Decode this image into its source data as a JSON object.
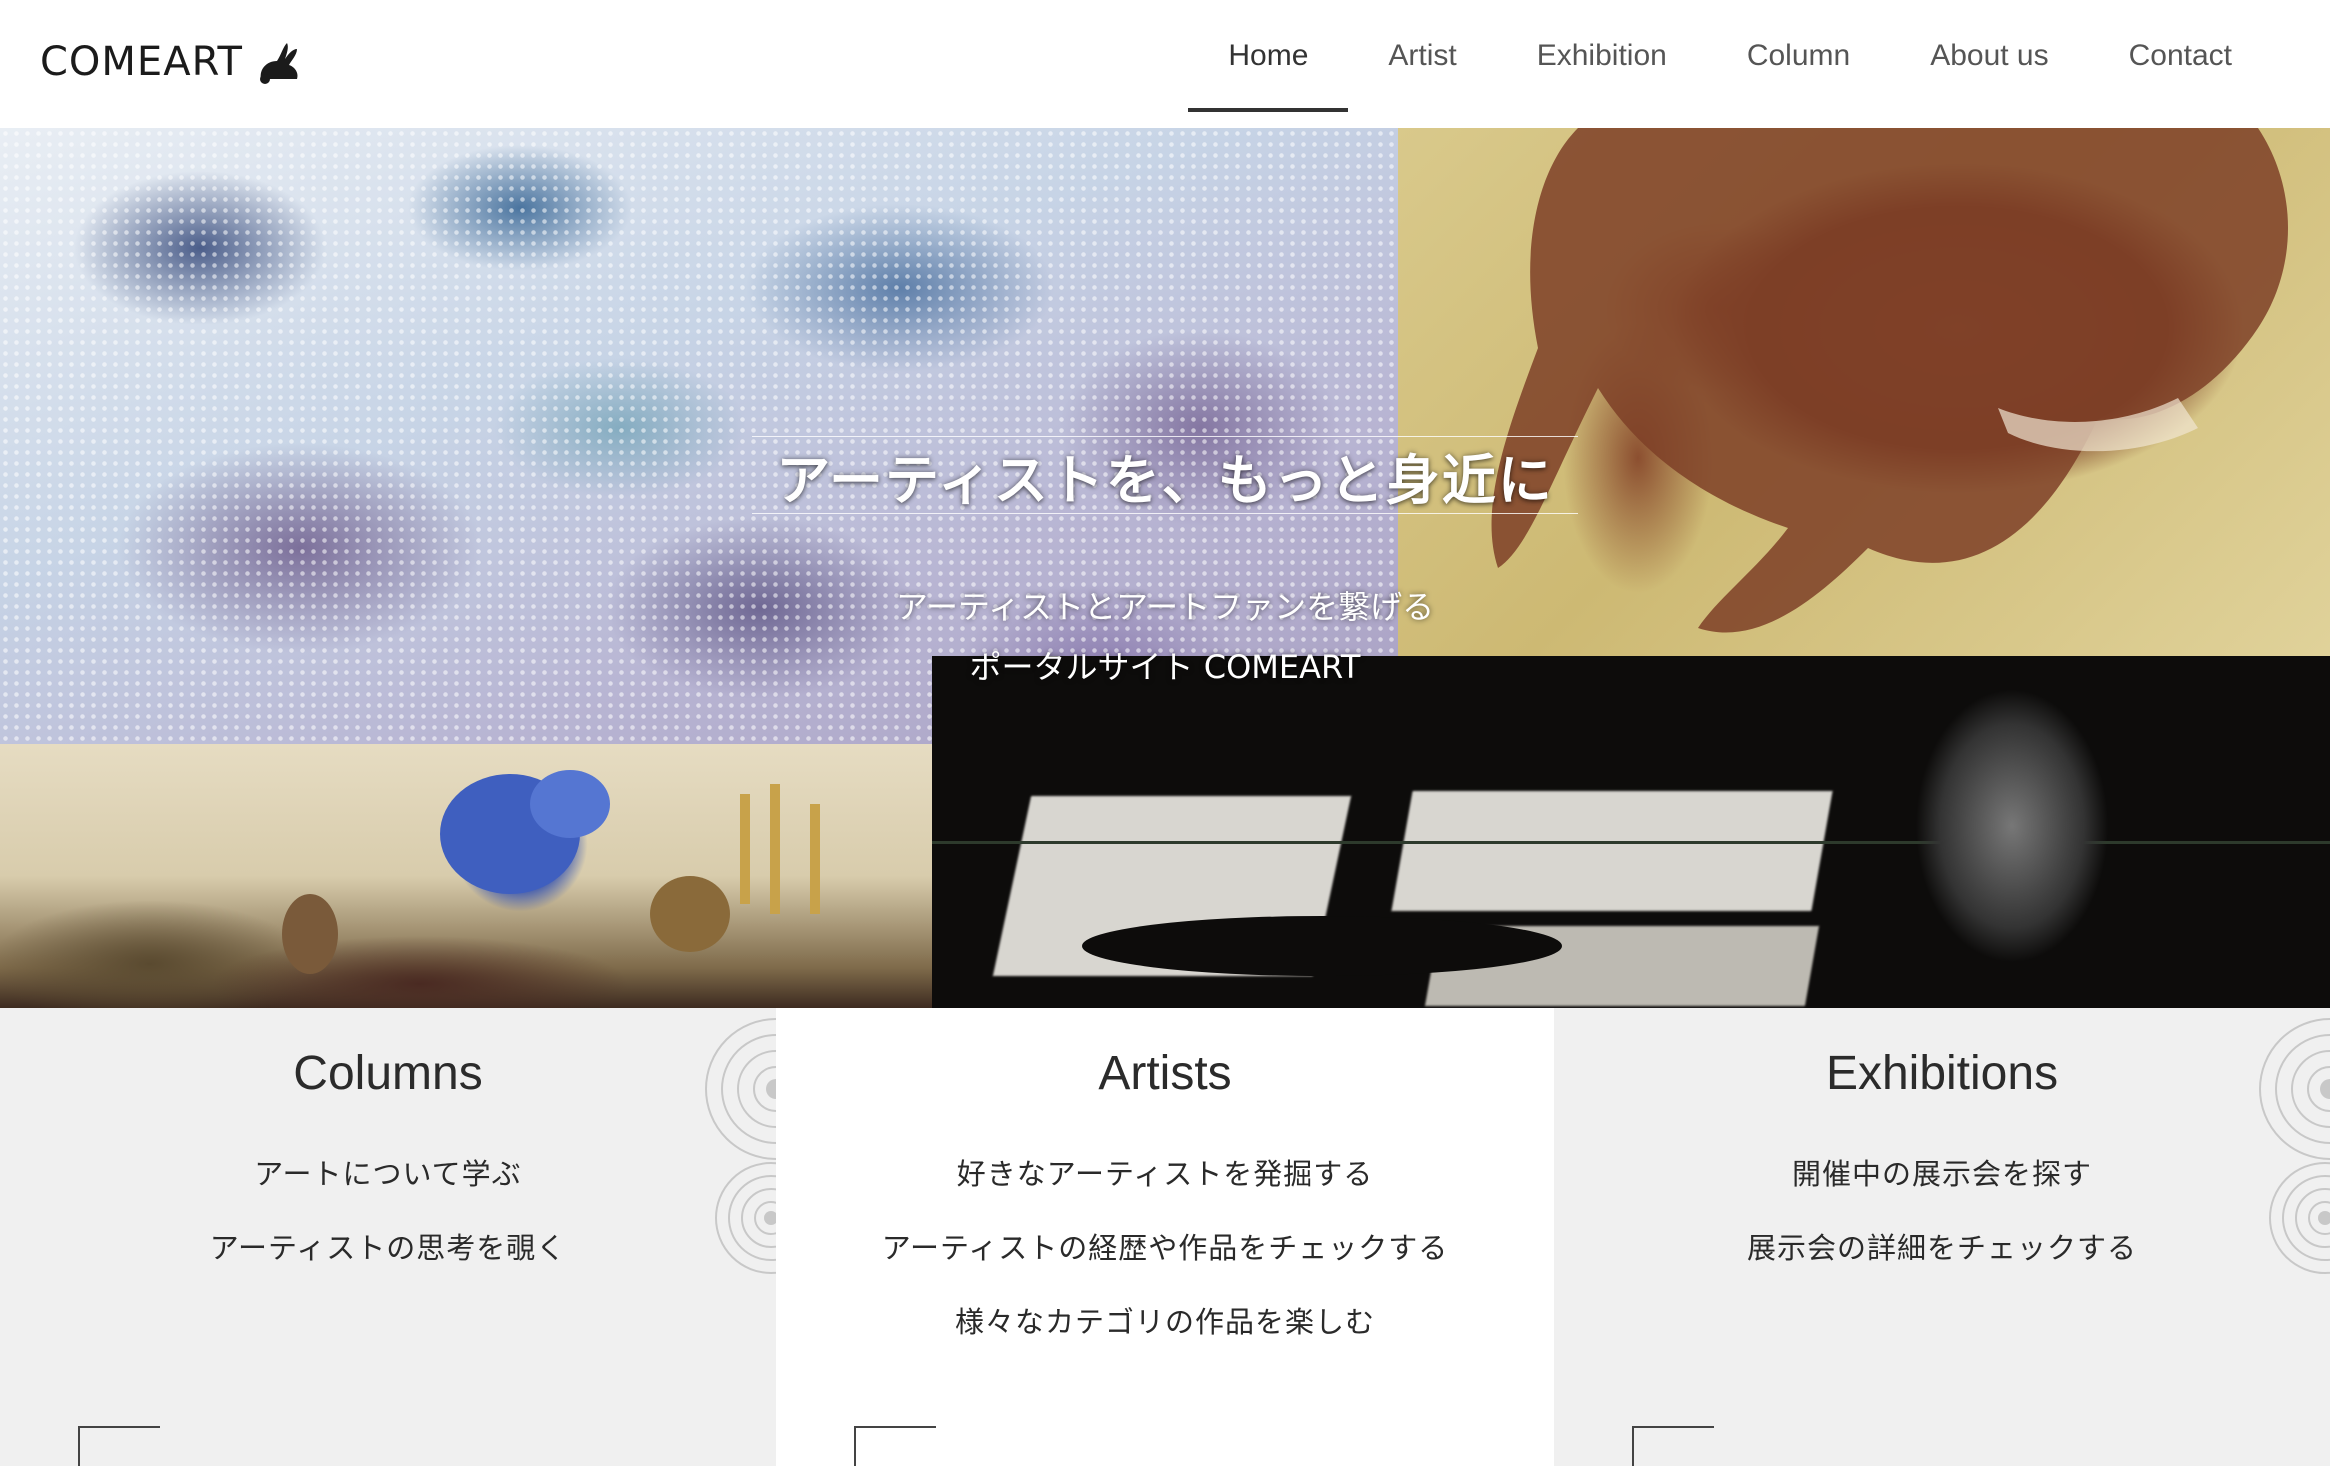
{
  "header": {
    "logo_text": "COMEART",
    "logo_icon": "rabbit-icon",
    "nav": [
      {
        "label": "Home",
        "active": true
      },
      {
        "label": "Artist",
        "active": false
      },
      {
        "label": "Exhibition",
        "active": false
      },
      {
        "label": "Column",
        "active": false
      },
      {
        "label": "About us",
        "active": false
      },
      {
        "label": "Contact",
        "active": false
      }
    ]
  },
  "hero": {
    "title": "アーティストを、もっと身近に",
    "subtitle_line1": "アーティストとアートファンを繋げる",
    "subtitle_line2": "ポータルサイト COMEART"
  },
  "features": [
    {
      "title": "Columns",
      "lines": [
        "アートについて学ぶ",
        "アーティストの思考を覗く"
      ]
    },
    {
      "title": "Artists",
      "lines": [
        "好きなアーティストを発掘する",
        "アーティストの経歴や作品をチェックする",
        "様々なカテゴリの作品を楽しむ"
      ]
    },
    {
      "title": "Exhibitions",
      "lines": [
        "開催中の展示会を探す",
        "展示会の詳細をチェックする"
      ]
    }
  ],
  "colors": {
    "header_bg": "#ffffff",
    "nav_active_underline": "#333333",
    "feature_grey": "#f0f0f0",
    "feature_white": "#ffffff"
  }
}
